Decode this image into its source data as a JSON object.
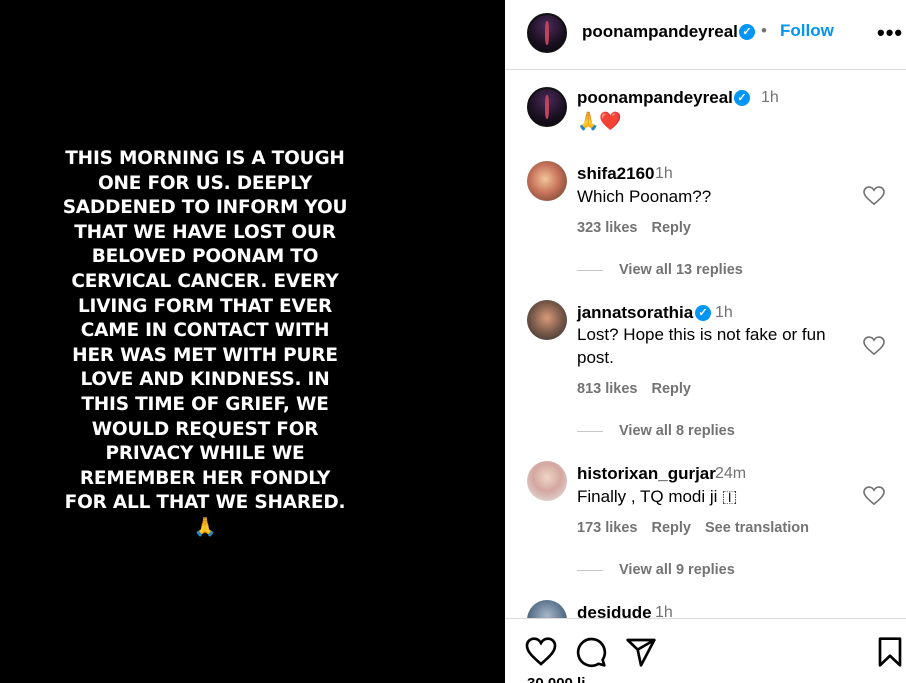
{
  "media": {
    "caption": "THIS MORNING IS A TOUGH ONE FOR US. DEEPLY SADDENED TO INFORM YOU THAT WE HAVE LOST OUR BELOVED POONAM TO CERVICAL CANCER. EVERY LIVING FORM THAT EVER CAME IN CONTACT WITH HER WAS MET WITH PURE LOVE AND KINDNESS. IN THIS TIME OF GRIEF, WE WOULD REQUEST FOR PRIVACY WHILE WE REMEMBER HER FONDLY FOR ALL THAT WE SHARED. 🙏"
  },
  "header": {
    "username": "poonampandeyreal",
    "dot": "•",
    "follow_label": "Follow",
    "more": "•••"
  },
  "post": {
    "username": "poonampandeyreal",
    "time": "1h",
    "text": "🙏❤️"
  },
  "comments": [
    {
      "username": "shifa2160",
      "time": "1h",
      "text": "Which Poonam??",
      "likes": "323 likes",
      "reply": "Reply",
      "view_replies": "View all 13 replies"
    },
    {
      "username": "jannatsorathia",
      "time": "1h",
      "text": "Lost? Hope this is not fake or fun post.",
      "likes": "813 likes",
      "reply": "Reply",
      "view_replies": "View all 8 replies"
    },
    {
      "username": "historixan_gurjar",
      "time": "24m",
      "text": "Finally , TQ modi ji 🇮",
      "likes": "173 likes",
      "reply": "Reply",
      "see_translation": "See translation",
      "view_replies": "View all 9 replies"
    },
    {
      "username": "desidude",
      "time": "1h"
    }
  ],
  "footer": {
    "likes_peek": "30,000 li"
  },
  "colors": {
    "accent": "#0095f6",
    "muted": "#737373",
    "border": "#dbdbdb"
  }
}
